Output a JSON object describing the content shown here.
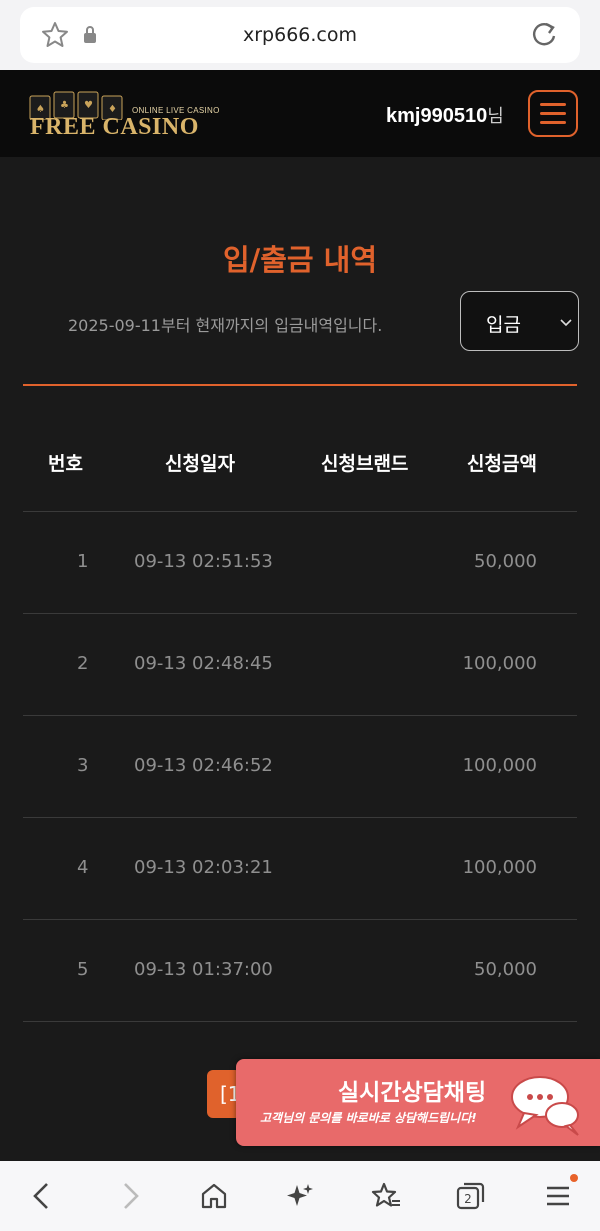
{
  "browser": {
    "url": "xrp666.com",
    "tabs_count": "2",
    "icons": [
      "favorite-star-icon",
      "lock-icon",
      "refresh-icon",
      "back-icon",
      "forward-icon",
      "home-icon",
      "sparkle-icon",
      "bookmarks-icon",
      "tabs-icon",
      "menu-icon"
    ]
  },
  "header": {
    "logo_sub": "ONLINE LIVE CASINO",
    "logo_main": "FREE CASINO",
    "username": "kmj990510",
    "username_suffix": "님"
  },
  "main": {
    "title": "입/출금 내역",
    "info": "2025-09-11부터 현재까지의 입금내역입니다.",
    "type_select": {
      "selected": "입금"
    },
    "columns": [
      "번호",
      "신청일자",
      "신청브랜드",
      "신청금액"
    ],
    "rows": [
      {
        "no": "1",
        "date": "09-13 02:51:53",
        "brand": "",
        "amount": "50,000"
      },
      {
        "no": "2",
        "date": "09-13 02:48:45",
        "brand": "",
        "amount": "100,000"
      },
      {
        "no": "3",
        "date": "09-13 02:46:52",
        "brand": "",
        "amount": "100,000"
      },
      {
        "no": "4",
        "date": "09-13 02:03:21",
        "brand": "",
        "amount": "100,000"
      },
      {
        "no": "5",
        "date": "09-13 01:37:00",
        "brand": "",
        "amount": "50,000"
      }
    ],
    "pagination_current": "[1"
  },
  "chat": {
    "title": "실시간상담채팅",
    "subtitle": "고객님의 문의를 바로바로 상담해드립니다!"
  },
  "colors": {
    "accent": "#e0622c",
    "background": "#1a1a1a",
    "header": "#0b0b0b",
    "chat_banner": "#e86a6a"
  }
}
